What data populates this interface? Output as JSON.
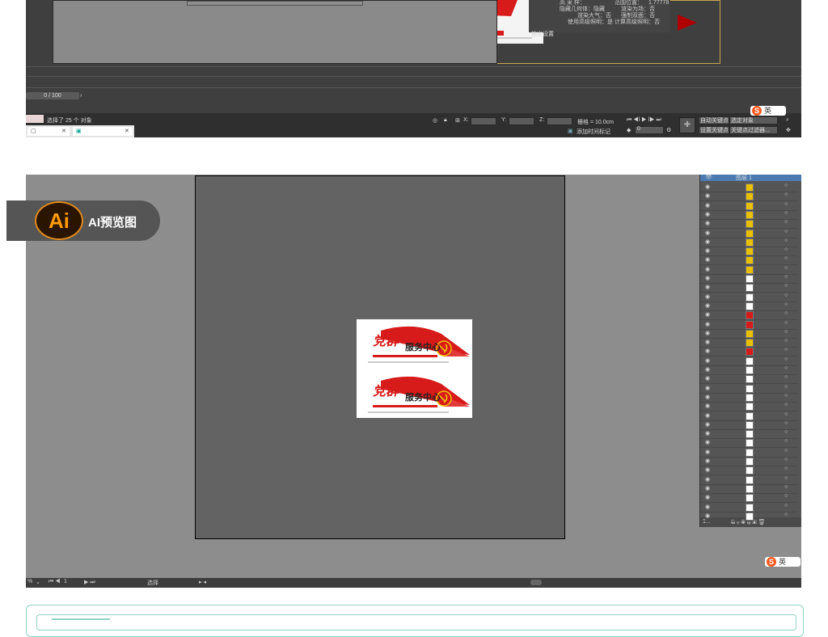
{
  "top_panel": {
    "props_rows": [
      {
        "left": "高 采 样：",
        "right": "范围位置：",
        "right_val": "1.77778"
      },
      {
        "left": "隐藏几何体：隐藏",
        "right": "渲染为场：否"
      },
      {
        "left": "渲染大气：否",
        "right": "强制双面：否"
      },
      {
        "left": "使用高级照明：是",
        "right": "计算高级照明：否"
      }
    ],
    "output_label": "输出设置",
    "time_slider": "0 / 100",
    "selection_status": "选择了 25 个 对象",
    "x_label": "X:",
    "y_label": "Y:",
    "z_label": "Z:",
    "grid_label": "栅格 = 10.0cm",
    "add_time_tag": "添加时间标记",
    "auto_key": "自动关键点",
    "set_key": "设置关键点",
    "selected_object": "选定对象",
    "key_filter": "关键点过滤器...",
    "frame_value": "0",
    "ime_label": "英"
  },
  "ai_panel": {
    "badge_logo": "Ai",
    "badge_label": "AI预览图",
    "layer_name": "图层 1",
    "status_zoom": "%",
    "status_page": "1",
    "status_tool": "选择",
    "ime_label": "英",
    "layer_count": "1..."
  },
  "artwork": {
    "title_script": "党群",
    "title_bold": "服务中心"
  },
  "colors": {
    "max_bg": "#3f3f3f",
    "ai_bg": "#8d8d8d",
    "artboard": "#636363",
    "teal": "#8fd3c4",
    "party_red": "#d71a1a",
    "ai_orange": "#ff9a00"
  }
}
